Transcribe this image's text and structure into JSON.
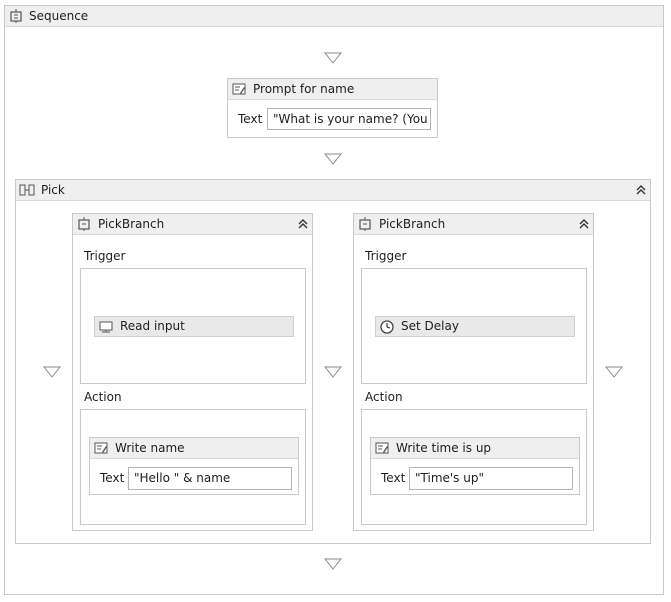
{
  "sequence": {
    "title": "Sequence"
  },
  "prompt": {
    "title": "Prompt for name",
    "field_label": "Text",
    "field_value": "\"What is your name? (You ha"
  },
  "pick": {
    "title": "Pick"
  },
  "branches": [
    {
      "title": "PickBranch",
      "trigger_label": "Trigger",
      "trigger_activity": "Read input",
      "action_label": "Action",
      "action_title": "Write name",
      "field_label": "Text",
      "field_value": "\"Hello \" & name"
    },
    {
      "title": "PickBranch",
      "trigger_label": "Trigger",
      "trigger_activity": "Set Delay",
      "action_label": "Action",
      "action_title": "Write time is up",
      "field_label": "Text",
      "field_value": "\"Time's up\""
    }
  ],
  "icons": {
    "sequence": "sequence-icon",
    "writeline": "writeline-icon",
    "pick": "pick-icon",
    "pickbranch": "pickbranch-icon",
    "read": "read-input-icon",
    "delay": "clock-icon",
    "collapse": "collapse-chevrons-icon",
    "drop": "drop-target-triangle-icon"
  },
  "colors": {
    "header_bg": "#efefef",
    "border": "#c9c9c9",
    "text": "#1e1e1e"
  }
}
